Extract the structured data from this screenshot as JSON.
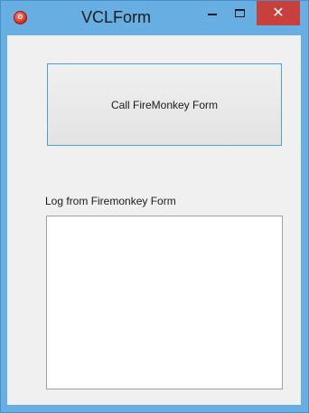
{
  "window": {
    "title": "VCLForm",
    "close_glyph": "✕",
    "accent_color": "#67aee3",
    "close_color": "#c8403b"
  },
  "main": {
    "call_button_label": "Call FireMonkey Form",
    "log_label": "Log from Firemonkey Form",
    "log_value": ""
  },
  "icons": [
    "app-icon",
    "minimize-icon",
    "maximize-icon",
    "close-icon"
  ]
}
